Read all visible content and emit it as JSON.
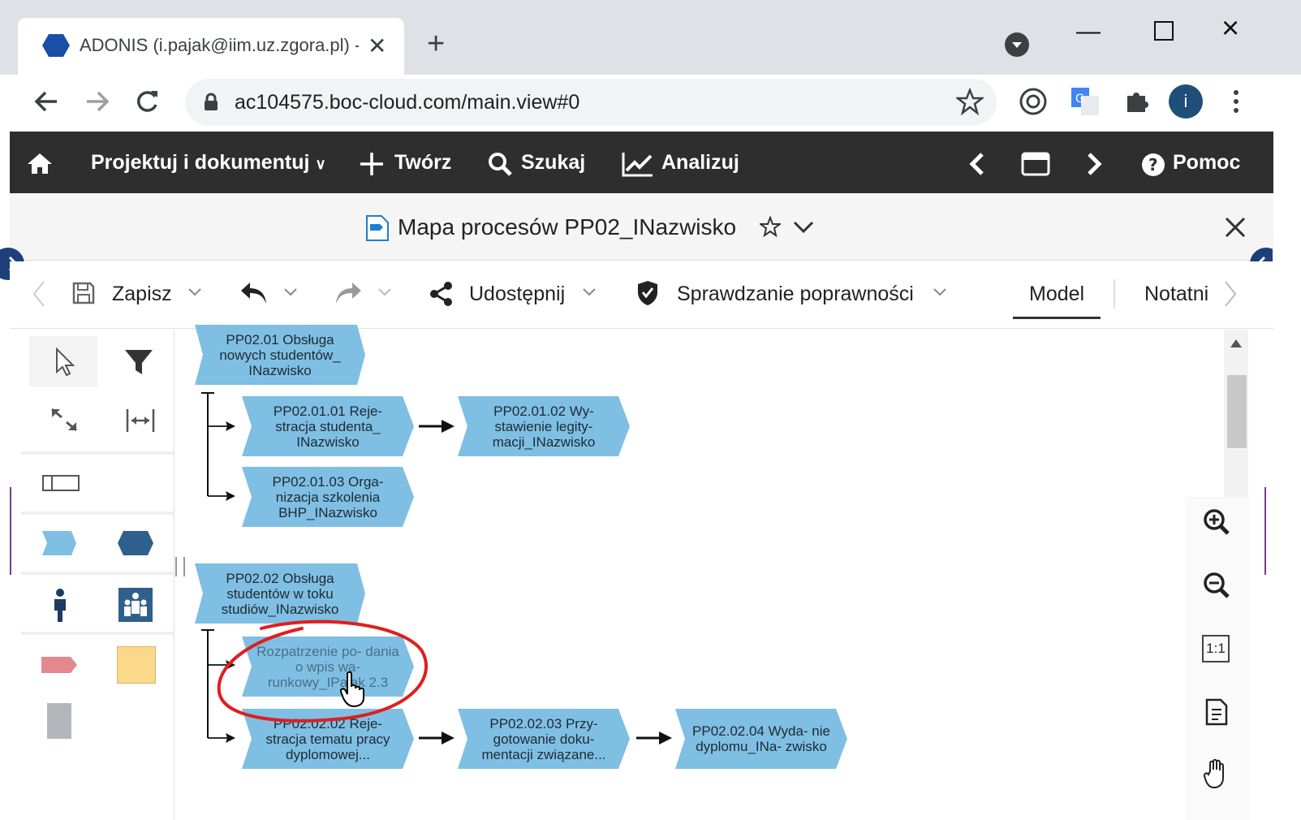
{
  "browser": {
    "tab_title": "ADONIS (i.pajak@iim.uz.zgora.pl) - ",
    "tab_close": "✕",
    "new_tab": "+",
    "url": "ac104575.boc-cloud.com/main.view#0",
    "avatar_letter": "i"
  },
  "nav": {
    "design_menu": "Projektuj i dokumentuj",
    "create": "Twórz",
    "search": "Szukaj",
    "analyze": "Analizuj",
    "help": "Pomoc"
  },
  "model": {
    "title": "Mapa procesów PP02_INazwisko"
  },
  "toolbar": {
    "save": "Zapisz",
    "share": "Udostępnij",
    "validation": "Sprawdzanie poprawności",
    "tab_model": "Model",
    "tab_notebook": "Notatni"
  },
  "diagram": {
    "g1": {
      "main": "PP02.01 Obsługa nowych studentów_ INazwisko",
      "p1": "PP02.01.01 Reje- stracja studenta_ INazwisko",
      "p2": "PP02.01.02 Wy- stawienie legity- macji_INazwisko",
      "p3": "PP02.01.03 Orga- nizacja szkolenia BHP_INazwisko"
    },
    "g2": {
      "main": "PP02.02 Obsługa studentów w toku studiów_INazwisko",
      "p1": "Rozpatrzenie po- dania o wpis wa- runkowy_IPajak 2.3",
      "p2": "PP02.02.02 Reje- stracja tematu pracy dyplomowej...",
      "p3": "PP02.02.03 Przy- gotowanie doku- mentacji związane...",
      "p4": "PP02.02.04 Wyda- nie dyplomu_INa- zwisko"
    }
  },
  "zoom": {
    "one_to_one": "1:1"
  },
  "colors": {
    "process_fill": "#7fbfe3",
    "nav_bg": "#2e2e2e",
    "annotation": "#e01e1e"
  }
}
